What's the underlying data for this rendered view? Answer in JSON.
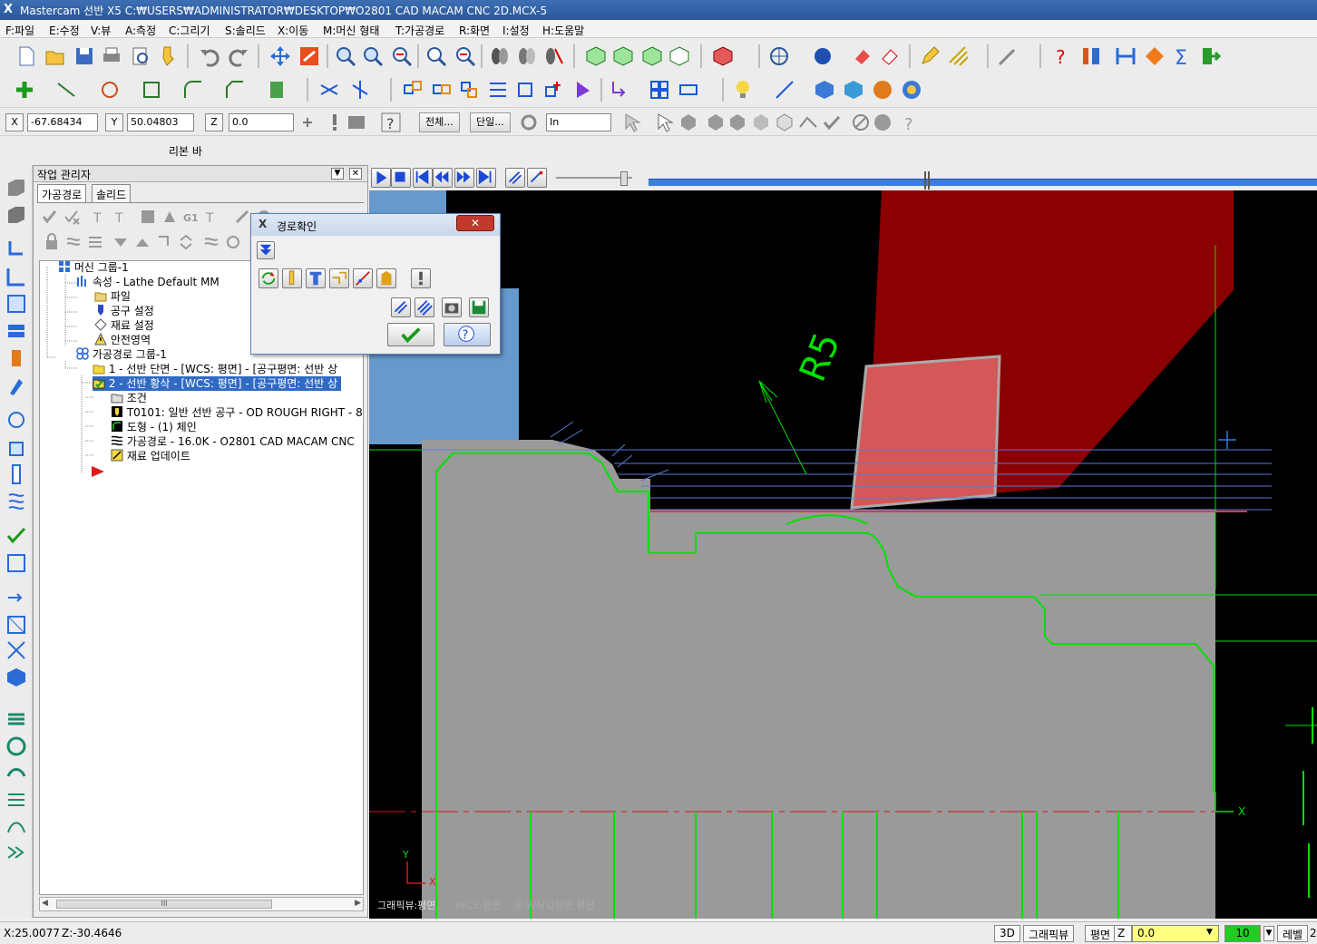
{
  "window": {
    "title": "Mastercam 선반 X5   C:₩USERS₩ADMINISTRATOR₩DESKTOP₩O2801 CAD MACAM CNC 2D.MCX-5"
  },
  "menu": [
    "F:파일",
    "E:수정",
    "V:뷰",
    "A:측정",
    "C:그리기",
    "S:솔리드",
    "X:이동",
    "M:머신 형태",
    "T:가공경로",
    "R:화면",
    "I:설정",
    "H:도움말"
  ],
  "coords": {
    "x_label": "X",
    "x_value": "-67.68434",
    "y_label": "Y",
    "y_value": "50.04803",
    "z_label": "Z",
    "z_value": "0.0",
    "select_all": "전체...",
    "select_single": "단일...",
    "select_mode": "In"
  },
  "ribbon": {
    "label": "리본 바"
  },
  "op_manager": {
    "title": "작업 관리자",
    "tabs": [
      "가공경로",
      "솔리드"
    ],
    "tree": {
      "machine_group": "머신 그룹-1",
      "properties": "속성 - Lathe Default MM",
      "files": "파일",
      "tool_settings": "공구 설정",
      "stock_setup": "재료 설정",
      "safety_zone": "안전영역",
      "toolpath_group": "가공경로 그룹-1",
      "op1": "1 - 선반 단면 - [WCS: 평면] - [공구평면: 선반 상",
      "op2": "2 - 선반 황삭 - [WCS: 평면] - [공구평면: 선반 상",
      "parameters": "조건",
      "tool": "T0101: 일반 선반 공구 - OD ROUGH RIGHT - 8",
      "geometry": "도형 - (1) 체인",
      "toolpath": "가공경로 - 16.0K - O2801 CAD MACAM CNC",
      "stock_update": "재료 업데이트"
    },
    "hscroll": "III"
  },
  "dialog": {
    "title": "경로확인"
  },
  "viewport": {
    "annotation": "R5",
    "axis_x": "X",
    "axis_y": "Y",
    "view_info": {
      "graphic_view": "그래픽뷰:평면",
      "wcs": "WCS:평면",
      "tool_plane": "공구/작업평면:평면"
    }
  },
  "status": {
    "x_coord": "X:25.0077",
    "z_coord": "Z:-30.4646",
    "mode_3d": "3D",
    "graphic_view": "그래픽뷰",
    "plane": "평면",
    "z_label": "Z",
    "z_value": "0.0",
    "level_value": "10",
    "level_label": "레벨",
    "extra": "2"
  },
  "colors": {
    "title_bar": "#2a5699",
    "toolpath": "#00e000",
    "stock": "#9a9a9a",
    "tool_holder": "#8b0000",
    "insert": "#c84a4a",
    "selected_row": "#316ac5"
  }
}
